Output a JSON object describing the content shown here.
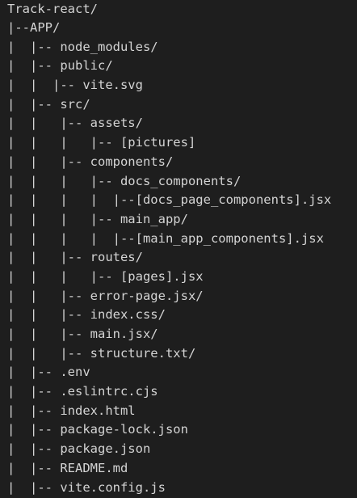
{
  "editor": {
    "lines": [
      "Track-react/",
      "|--APP/",
      "|  |-- node_modules/",
      "|  |-- public/",
      "|  |  |-- vite.svg",
      "|  |-- src/",
      "|  |   |-- assets/",
      "|  |   |   |-- [pictures]",
      "|  |   |-- components/",
      "|  |   |   |-- docs_components/",
      "|  |   |   |  |--[docs_page_components].jsx",
      "|  |   |   |-- main_app/",
      "|  |   |   |  |--[main_app_components].jsx",
      "|  |   |-- routes/",
      "|  |   |   |-- [pages].jsx",
      "|  |   |-- error-page.jsx/",
      "|  |   |-- index.css/",
      "|  |   |-- main.jsx/",
      "|  |   |-- structure.txt/",
      "|  |-- .env",
      "|  |-- .eslintrc.cjs",
      "|  |-- index.html",
      "|  |-- package-lock.json",
      "|  |-- package.json",
      "|  |-- README.md",
      "|  |-- vite.config.js"
    ]
  }
}
